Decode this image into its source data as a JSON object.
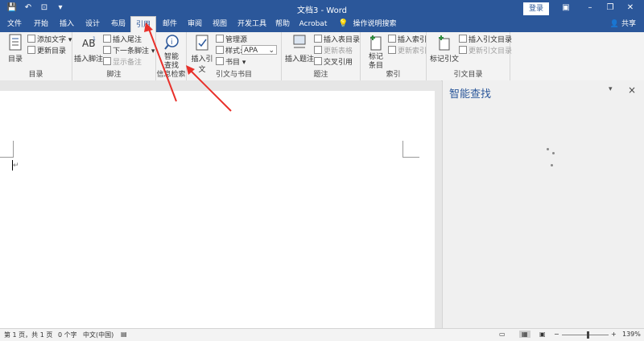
{
  "titlebar": {
    "title": "文档3 - Word",
    "login_label": "登录",
    "qat": [
      "save-icon",
      "undo-icon",
      "touch-mode-icon",
      "customize-icon"
    ]
  },
  "tabs": [
    {
      "label": "文件"
    },
    {
      "label": "开始"
    },
    {
      "label": "插入"
    },
    {
      "label": "设计"
    },
    {
      "label": "布局"
    },
    {
      "label": "引用",
      "active": true
    },
    {
      "label": "邮件"
    },
    {
      "label": "审阅"
    },
    {
      "label": "视图"
    },
    {
      "label": "开发工具"
    },
    {
      "label": "帮助"
    },
    {
      "label": "Acrobat"
    }
  ],
  "tellme": "操作说明搜索",
  "share": "共享",
  "ribbon": {
    "toc": {
      "big": "目录",
      "add_text": "添加文字",
      "update": "更新目录",
      "group": "目录"
    },
    "footnotes": {
      "big": "插入脚注",
      "insert_endnote": "插入尾注",
      "next_footnote": "下一条脚注",
      "show_notes": "显示备注",
      "group": "脚注"
    },
    "research": {
      "big": "智能查找",
      "group": "信息检索"
    },
    "citations": {
      "big": "插入引文",
      "manage": "管理源",
      "style_label": "样式:",
      "style_value": "APA",
      "bibliography": "书目",
      "group": "引文与书目"
    },
    "captions": {
      "big": "插入题注",
      "insert_table": "插入表目录",
      "update_table": "更新表格",
      "cross_ref": "交叉引用",
      "group": "题注"
    },
    "index": {
      "big": "标记条目",
      "insert": "插入索引",
      "update": "更新索引",
      "group": "索引"
    },
    "toa": {
      "big": "标记引文",
      "insert": "插入引文目录",
      "update": "更新引文目录",
      "group": "引文目录"
    }
  },
  "pane": {
    "title": "智能查找"
  },
  "status": {
    "page": "第 1 页，共 1 页",
    "words": "0 个字",
    "lang": "中文(中国)",
    "zoom": "139%"
  },
  "colors": {
    "accent": "#2b579a",
    "arrow": "#e8302a"
  }
}
